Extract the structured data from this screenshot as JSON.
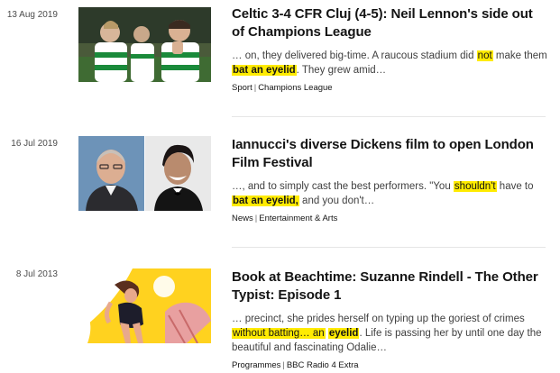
{
  "results": [
    {
      "date": "13 Aug 2019",
      "title": "Celtic 3-4 CFR Cluj (4-5): Neil Lennon's side out of Champions League",
      "summary": {
        "pre": "… on, they delivered big-time. A raucous stadium did ",
        "hl1": "not",
        "mid1": " make them ",
        "hl2": "bat an eyelid",
        "post": ". They grew amid…"
      },
      "meta": [
        "Sport",
        "Champions League"
      ],
      "image_icon": "football-players-photo"
    },
    {
      "date": "16 Jul 2019",
      "title": "Iannucci's diverse Dickens film to open London Film Festival",
      "summary": {
        "pre": "…, and to simply cast the best performers. \"You ",
        "hl1": "shouldn't",
        "mid1": " have to ",
        "hl2": "bat an eyelid,",
        "post": " and you don't…"
      },
      "meta": [
        "News",
        "Entertainment & Arts"
      ],
      "image_icon": "portrait-photos"
    },
    {
      "date": "8 Jul 2013",
      "title": "Book at Beachtime: Suzanne Rindell - The Other Typist: Episode 1",
      "summary": {
        "pre": "… precinct, she prides herself on typing up the goriest of crimes ",
        "hl1": "without batting… an",
        "mid1": " ",
        "hl2": "eyelid",
        "post": ". Life is passing her by until one day the beautiful and fascinating Odalie…"
      },
      "meta": [
        "Programmes",
        "BBC Radio 4 Extra"
      ],
      "image_icon": "beach-illustration"
    }
  ],
  "colors": {
    "highlight": "#ffeb00",
    "divider": "#e6e6e6",
    "text": "#141414"
  }
}
